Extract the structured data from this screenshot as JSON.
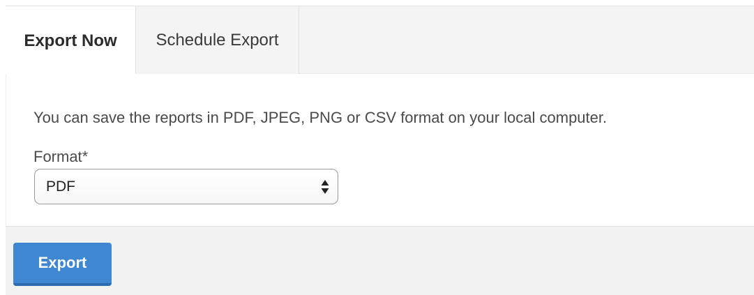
{
  "tabs": [
    {
      "label": "Export Now",
      "active": true
    },
    {
      "label": "Schedule Export",
      "active": false
    }
  ],
  "content": {
    "description": "You can save the reports in PDF, JPEG, PNG or CSV format on your local computer.",
    "format_label": "Format*",
    "format_selected": "PDF"
  },
  "footer": {
    "export_label": "Export"
  },
  "icons": {
    "select_arrows": "chevron-up-down-icon"
  },
  "colors": {
    "accent": "#3f87d0",
    "footer_bg": "#f2f2f2",
    "tab_bg": "#f4f4f4"
  }
}
